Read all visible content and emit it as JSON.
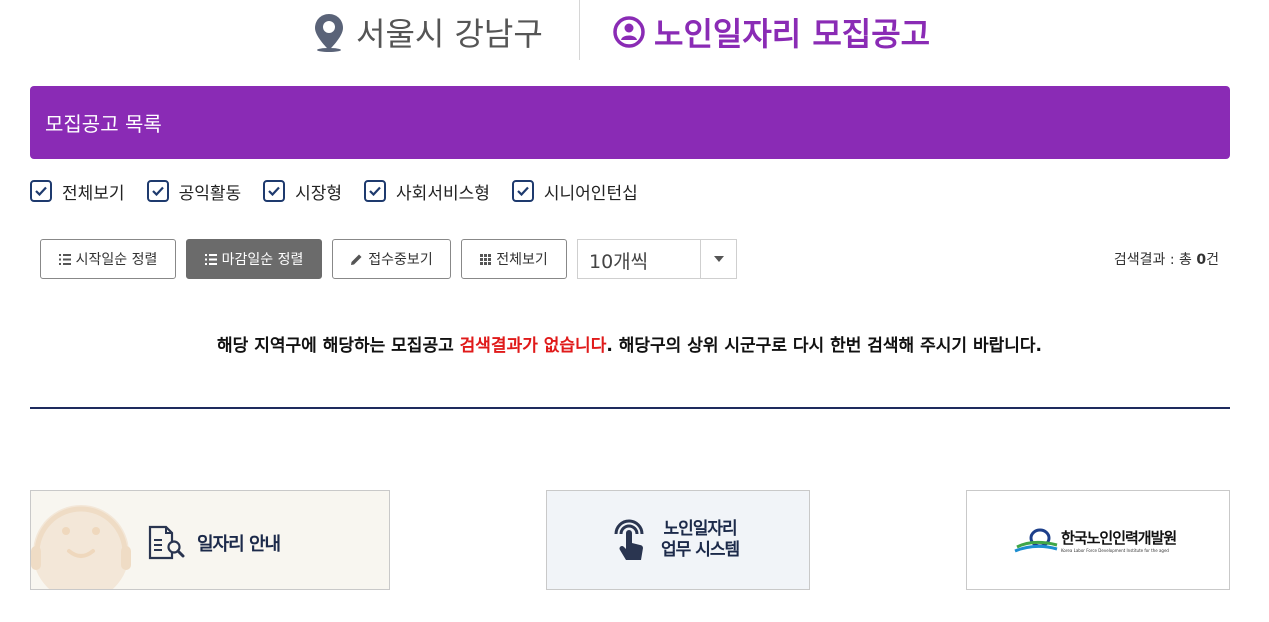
{
  "header": {
    "region": "서울시 강남구",
    "page_title": "노인일자리 모집공고",
    "accent": "#8a2bb5"
  },
  "list_bar": {
    "title": "모집공고 목록"
  },
  "filters": [
    {
      "label": "전체보기",
      "checked": true
    },
    {
      "label": "공익활동",
      "checked": true
    },
    {
      "label": "시장형",
      "checked": true
    },
    {
      "label": "사회서비스형",
      "checked": true
    },
    {
      "label": "시니어인턴십",
      "checked": true
    }
  ],
  "toolbar": {
    "sort_start": "시작일순 정렬",
    "sort_deadline": "마감일순 정렬",
    "receiving": "접수중보기",
    "view_all": "전체보기",
    "page_size": "10개씩",
    "result_prefix": "검색결과 : 총",
    "result_count": "0",
    "result_suffix": "건"
  },
  "message": {
    "part1": "해당 지역구에 해당하는 모집공고 ",
    "highlight": "검색결과가 없습니다",
    "part2": ". 해당구의 상위 시군구로 다시 한번 검색해 주시기 바랍니다."
  },
  "cards": {
    "job_info": "일자리 안내",
    "system_line1": "노인일자리",
    "system_line2": "업무 시스템",
    "institute_name": "한국노인인력개발원",
    "institute_sub": "Korea Labor Force Development Institute for the aged"
  },
  "icons": [
    "location-pin-icon",
    "user-circle-icon",
    "check-icon",
    "list-icon",
    "pencil-icon",
    "grid-icon",
    "caret-down-icon",
    "document-search-icon",
    "touch-icon",
    "institute-logo-icon"
  ]
}
